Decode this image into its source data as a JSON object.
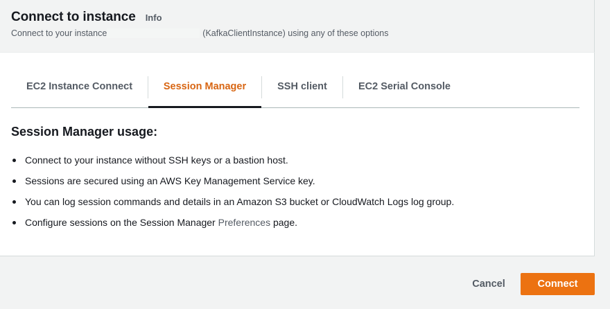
{
  "header": {
    "title": "Connect to instance",
    "info_link": "Info",
    "subtitle_prefix": "Connect to your instance",
    "subtitle_suffix": "(KafkaClientInstance) using any of these options"
  },
  "tabs": [
    {
      "label": "EC2 Instance Connect",
      "active": false
    },
    {
      "label": "Session Manager",
      "active": true
    },
    {
      "label": "SSH client",
      "active": false
    },
    {
      "label": "EC2 Serial Console",
      "active": false
    }
  ],
  "session_manager": {
    "heading": "Session Manager usage:",
    "items": [
      "Connect to your instance without SSH keys or a bastion host.",
      "Sessions are secured using an AWS Key Management Service key.",
      "You can log session commands and details in an Amazon S3 bucket or CloudWatch Logs log group."
    ],
    "last_item_prefix": "Configure sessions on the Session Manager",
    "last_item_link": "Preferences",
    "last_item_suffix": "page."
  },
  "footer": {
    "cancel_label": "Cancel",
    "connect_label": "Connect"
  },
  "colors": {
    "accent": "#ec7211",
    "active_tab": "#d86613",
    "text": "#16191f",
    "secondary_text": "#545b64"
  }
}
